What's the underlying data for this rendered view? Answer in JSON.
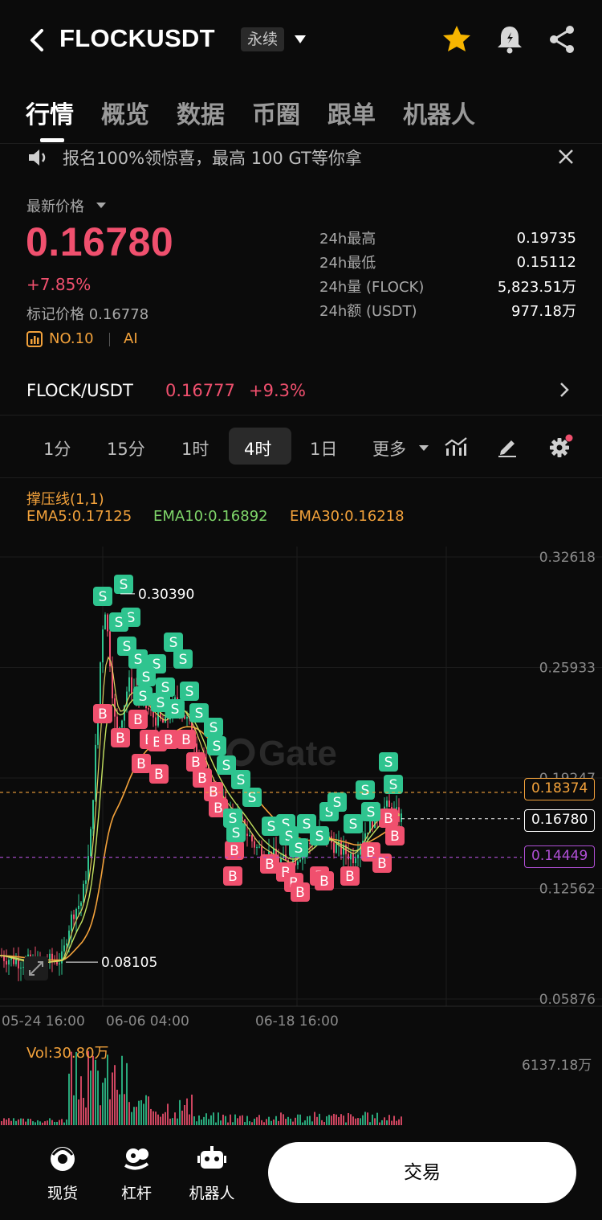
{
  "header": {
    "pair": "FLOCKUSDT",
    "contract_type": "永续",
    "icons": [
      "back-icon",
      "star-icon",
      "bell-icon",
      "share-icon"
    ]
  },
  "tabs": [
    "行情",
    "概览",
    "数据",
    "币圈",
    "跟单",
    "机器人"
  ],
  "banner": {
    "text": "报名100%领惊喜，最高 100 GT等你拿"
  },
  "price": {
    "label": "最新价格",
    "last": "0.16780",
    "change": "+7.85%",
    "mark": "标记价格 0.16778",
    "rank": "NO.10",
    "tag": "AI"
  },
  "stats": [
    {
      "label": "24h最高",
      "value": "0.19735"
    },
    {
      "label": "24h最低",
      "value": "0.15112"
    },
    {
      "label": "24h量 (FLOCK)",
      "value": "5,823.51万"
    },
    {
      "label": "24h额 (USDT)",
      "value": "977.18万"
    }
  ],
  "spot": {
    "name": "FLOCK/USDT",
    "price": "0.16777",
    "change": "+9.3%"
  },
  "intervals": [
    "1分",
    "15分",
    "1时",
    "4时",
    "1日",
    "更多"
  ],
  "active_interval": "4时",
  "indicators": {
    "title": "撑压线(1,1)",
    "ema5": "EMA5:0.17125",
    "ema10": "EMA10:0.16892",
    "ema30": "EMA30:0.16218"
  },
  "chart": {
    "y_ticks": [
      "0.32618",
      "0.25933",
      "0.19247",
      "0.12562",
      "0.05876"
    ],
    "x_ticks": [
      "05-24 16:00",
      "06-06 04:00",
      "06-18 16:00"
    ],
    "high_label": "0.30390",
    "low_label": "0.08105",
    "resistance": "0.18374",
    "current": "0.16780",
    "support": "0.14449",
    "watermark": "Gate",
    "colors": {
      "up": "#2fc48f",
      "down": "#f0506e",
      "ema5": "#f3a23b",
      "ema10": "#c3e05f",
      "ema30": "#f3a23b",
      "support": "#b04fd6"
    }
  },
  "volume": {
    "label": "Vol:30.80万",
    "max": "6137.18万"
  },
  "bottom_nav": [
    {
      "label": "现货",
      "icon": "spot-icon"
    },
    {
      "label": "杠杆",
      "icon": "leverage-icon"
    },
    {
      "label": "机器人",
      "icon": "robot-icon"
    }
  ],
  "trade_button": "交易"
}
